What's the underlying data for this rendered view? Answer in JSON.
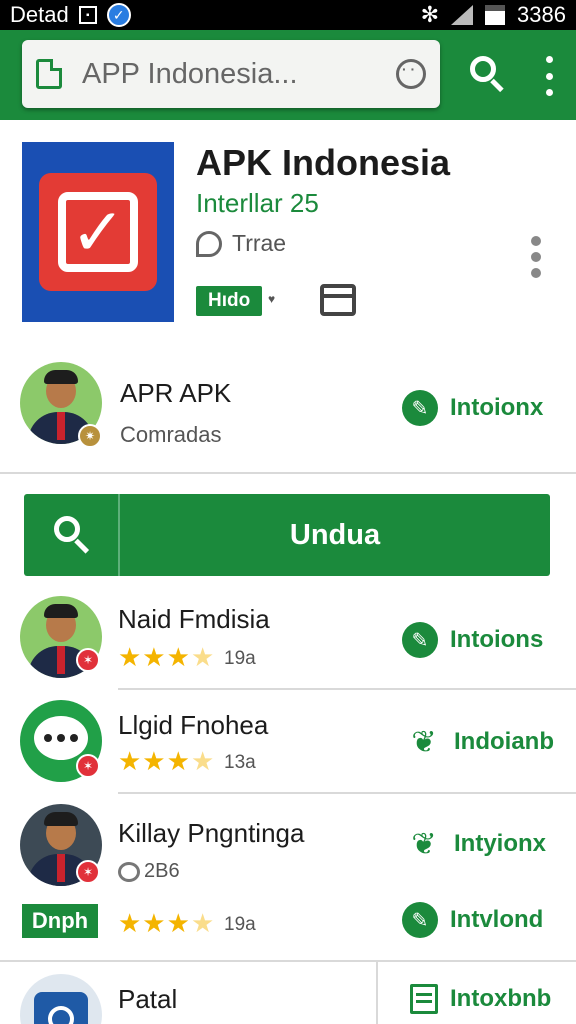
{
  "status_bar": {
    "carrier": "Detad",
    "time": "3386"
  },
  "search": {
    "query": "APP Indonesia..."
  },
  "app": {
    "title": "APK Indonesia",
    "subtitle": "Interllar 25",
    "trade_label": "Trrae",
    "tag": "Hıdo",
    "tag_extra": "♥"
  },
  "featured": {
    "name": "APR APK",
    "sub": "Comradas",
    "action": "Intoionx"
  },
  "download_button": {
    "label": "Undua"
  },
  "rows": [
    {
      "name": "Naid Fmdisia",
      "stars": "★★★",
      "rating": "19a",
      "action": "Intoions"
    },
    {
      "name": "Llgid Fnohea",
      "stars": "★★★",
      "rating": "13a",
      "action": "Indoianb"
    },
    {
      "name": "Killay Pngntinga",
      "comments": "2B6",
      "action": "Intyionx",
      "tag": "Dnph",
      "stars": "★★★",
      "rating": "19a",
      "action2": "Intvlond"
    },
    {
      "name": "Patal",
      "action": "Intoxbnb"
    }
  ],
  "colors": {
    "brand_green": "#1b8a3c",
    "icon_blue": "#1a4fb3",
    "icon_red": "#e33b35",
    "star": "#f4b400"
  },
  "icons": {
    "search": "search-icon",
    "menu": "more-vertical-icon",
    "app": "checkbox-icon",
    "edit": "edit-pencil-icon",
    "leaf": "leaf-icon",
    "list": "list-icon"
  }
}
